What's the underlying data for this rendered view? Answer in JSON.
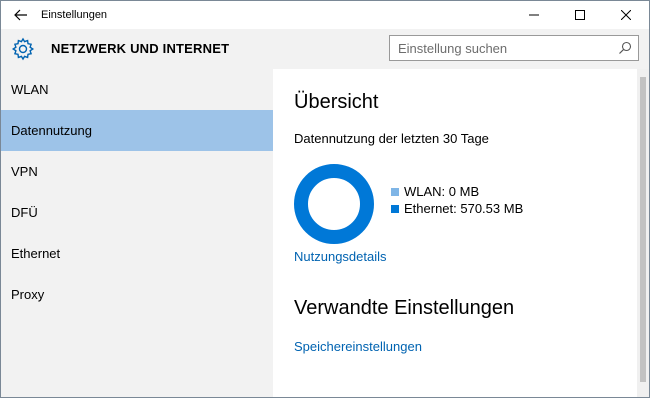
{
  "window": {
    "title": "Einstellungen"
  },
  "header": {
    "section_title": "NETZWERK UND INTERNET",
    "search_placeholder": "Einstellung suchen"
  },
  "sidebar": {
    "items": [
      {
        "label": "WLAN",
        "selected": false
      },
      {
        "label": "Datennutzung",
        "selected": true
      },
      {
        "label": "VPN",
        "selected": false
      },
      {
        "label": "DFÜ",
        "selected": false
      },
      {
        "label": "Ethernet",
        "selected": false
      },
      {
        "label": "Proxy",
        "selected": false
      }
    ]
  },
  "main": {
    "overview_heading": "Übersicht",
    "usage_caption": "Datennutzung der letzten 30 Tage",
    "legend": [
      {
        "label": "WLAN: 0 MB",
        "color": "#7fb5e6"
      },
      {
        "label": "Ethernet: 570.53 MB",
        "color": "#0078d7"
      }
    ],
    "usage_details_link": "Nutzungsdetails",
    "related_heading": "Verwandte Einstellungen",
    "storage_link": "Speichereinstellungen"
  },
  "colors": {
    "accent": "#0078d7",
    "link": "#0063b1",
    "selection": "#9dc3e8",
    "sidebar_bg": "#f2f2f2"
  }
}
